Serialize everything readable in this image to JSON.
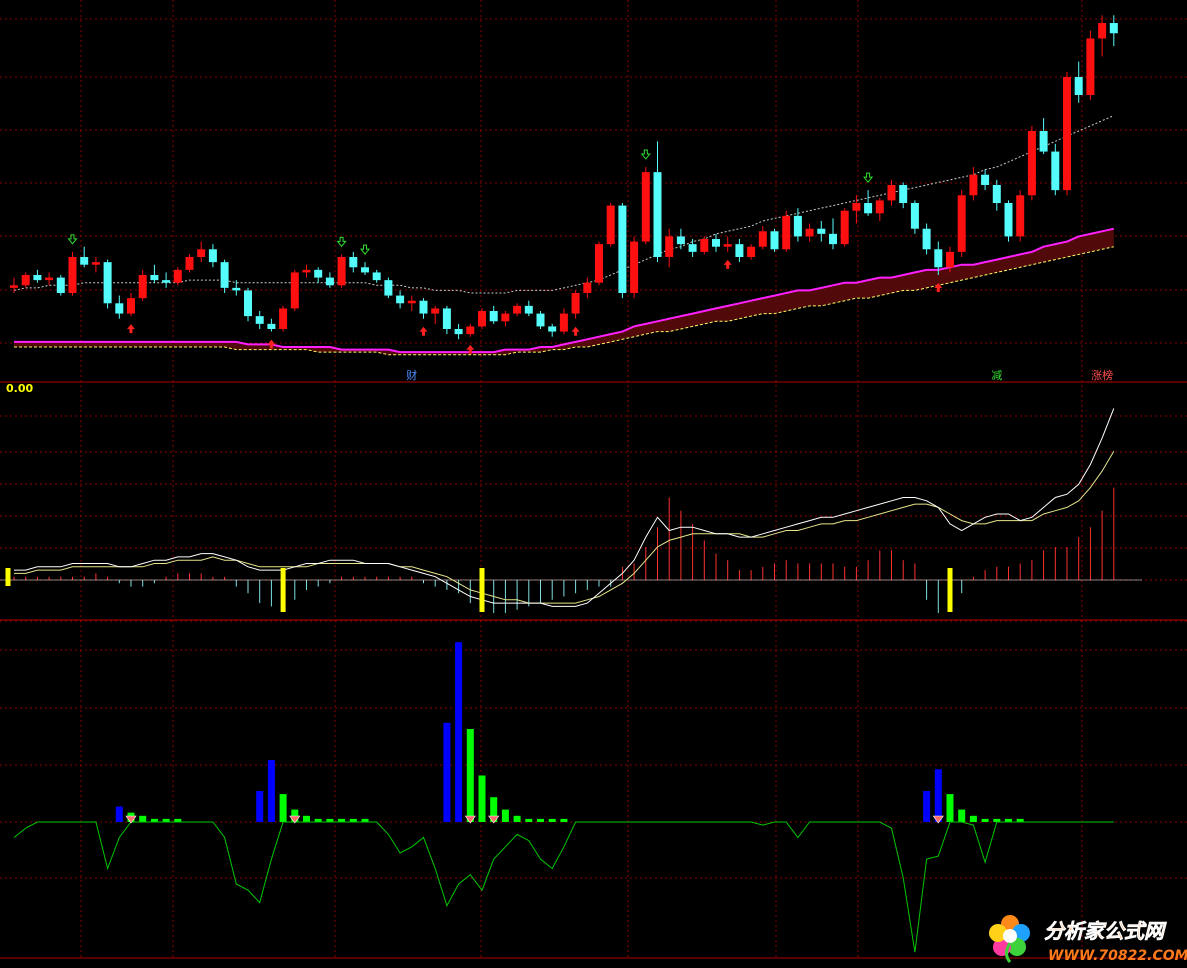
{
  "chart_data": [
    {
      "type": "candlestick",
      "panel": "price",
      "ohlc": [
        [
          300,
          304,
          298,
          301
        ],
        [
          301,
          306,
          300,
          305
        ],
        [
          305,
          307,
          302,
          303
        ],
        [
          303,
          306,
          301,
          304
        ],
        [
          304,
          305,
          297,
          298
        ],
        [
          298,
          314,
          297,
          312
        ],
        [
          312,
          316,
          308,
          309
        ],
        [
          309,
          312,
          306,
          310
        ],
        [
          310,
          311,
          292,
          294
        ],
        [
          294,
          297,
          288,
          290
        ],
        [
          290,
          298,
          289,
          296
        ],
        [
          296,
          307,
          295,
          305
        ],
        [
          305,
          309,
          302,
          303
        ],
        [
          303,
          306,
          300,
          302
        ],
        [
          302,
          308,
          301,
          307
        ],
        [
          307,
          313,
          306,
          312
        ],
        [
          312,
          318,
          310,
          315
        ],
        [
          315,
          317,
          308,
          310
        ],
        [
          310,
          311,
          298,
          300
        ],
        [
          300,
          303,
          297,
          299
        ],
        [
          299,
          300,
          287,
          289
        ],
        [
          289,
          291,
          284,
          286
        ],
        [
          286,
          288,
          283,
          284
        ],
        [
          284,
          293,
          283,
          292
        ],
        [
          292,
          307,
          291,
          306
        ],
        [
          306,
          309,
          304,
          307
        ],
        [
          307,
          308,
          302,
          304
        ],
        [
          304,
          306,
          300,
          301
        ],
        [
          301,
          313,
          300,
          312
        ],
        [
          312,
          314,
          306,
          308
        ],
        [
          308,
          310,
          305,
          306
        ],
        [
          306,
          307,
          302,
          303
        ],
        [
          303,
          304,
          296,
          297
        ],
        [
          297,
          299,
          292,
          294
        ],
        [
          294,
          297,
          291,
          295
        ],
        [
          295,
          296,
          288,
          290
        ],
        [
          290,
          293,
          286,
          292
        ],
        [
          292,
          293,
          282,
          284
        ],
        [
          284,
          286,
          280,
          282
        ],
        [
          282,
          286,
          281,
          285
        ],
        [
          285,
          292,
          284,
          291
        ],
        [
          291,
          293,
          286,
          287
        ],
        [
          287,
          291,
          285,
          290
        ],
        [
          290,
          294,
          289,
          293
        ],
        [
          293,
          295,
          289,
          290
        ],
        [
          290,
          291,
          284,
          285
        ],
        [
          285,
          286,
          281,
          283
        ],
        [
          283,
          292,
          282,
          290
        ],
        [
          290,
          299,
          288,
          298
        ],
        [
          298,
          304,
          296,
          302
        ],
        [
          302,
          318,
          301,
          317
        ],
        [
          317,
          333,
          316,
          332
        ],
        [
          332,
          333,
          296,
          298
        ],
        [
          298,
          320,
          296,
          318
        ],
        [
          318,
          347,
          317,
          345
        ],
        [
          345,
          357,
          310,
          312
        ],
        [
          312,
          323,
          308,
          320
        ],
        [
          320,
          323,
          315,
          317
        ],
        [
          317,
          319,
          312,
          314
        ],
        [
          314,
          320,
          313,
          319
        ],
        [
          319,
          321,
          314,
          316
        ],
        [
          316,
          320,
          314,
          317
        ],
        [
          317,
          319,
          310,
          312
        ],
        [
          312,
          317,
          311,
          316
        ],
        [
          316,
          324,
          315,
          322
        ],
        [
          322,
          323,
          314,
          315
        ],
        [
          315,
          330,
          314,
          328
        ],
        [
          328,
          331,
          318,
          320
        ],
        [
          320,
          325,
          318,
          323
        ],
        [
          323,
          326,
          318,
          321
        ],
        [
          321,
          327,
          315,
          317
        ],
        [
          317,
          331,
          316,
          330
        ],
        [
          330,
          336,
          325,
          333
        ],
        [
          333,
          338,
          328,
          329
        ],
        [
          329,
          335,
          326,
          334
        ],
        [
          334,
          342,
          332,
          340
        ],
        [
          340,
          341,
          331,
          333
        ],
        [
          333,
          334,
          321,
          323
        ],
        [
          323,
          325,
          313,
          315
        ],
        [
          315,
          318,
          305,
          308
        ],
        [
          308,
          316,
          306,
          314
        ],
        [
          314,
          338,
          312,
          336
        ],
        [
          336,
          347,
          334,
          344
        ],
        [
          344,
          346,
          338,
          340
        ],
        [
          340,
          342,
          330,
          333
        ],
        [
          333,
          334,
          318,
          320
        ],
        [
          320,
          338,
          318,
          336
        ],
        [
          336,
          363,
          334,
          361
        ],
        [
          361,
          366,
          352,
          353
        ],
        [
          353,
          356,
          336,
          338
        ],
        [
          338,
          384,
          336,
          382
        ],
        [
          382,
          388,
          372,
          375
        ],
        [
          375,
          400,
          373,
          397
        ],
        [
          397,
          406,
          390,
          403
        ],
        [
          403,
          406,
          394,
          399
        ]
      ],
      "ma_long": [
        299,
        300,
        300,
        301,
        301,
        301,
        302,
        302,
        302,
        302,
        302,
        302,
        302,
        302,
        302,
        303,
        303,
        303,
        303,
        302,
        302,
        302,
        302,
        302,
        302,
        302,
        302,
        302,
        302,
        302,
        302,
        301,
        301,
        301,
        300,
        300,
        299,
        299,
        299,
        298,
        298,
        298,
        298,
        299,
        299,
        299,
        299,
        300,
        301,
        302,
        303,
        305,
        307,
        309,
        311,
        313,
        315,
        316,
        318,
        319,
        321,
        322,
        323,
        324,
        326,
        327,
        328,
        329,
        330,
        331,
        332,
        333,
        334,
        335,
        336,
        337,
        338,
        339,
        340,
        341,
        342,
        343,
        344,
        346,
        347,
        349,
        351,
        353,
        355,
        357,
        359,
        361,
        363,
        365,
        367
      ],
      "ma_mid": [
        279,
        279,
        279,
        279,
        279,
        279,
        279,
        279,
        279,
        279,
        279,
        279,
        279,
        279,
        279,
        279,
        279,
        279,
        279,
        279,
        278,
        278,
        278,
        277,
        277,
        277,
        277,
        277,
        276,
        276,
        276,
        276,
        276,
        275,
        275,
        275,
        275,
        275,
        275,
        275,
        275,
        275,
        276,
        276,
        276,
        277,
        277,
        278,
        279,
        280,
        281,
        282,
        283,
        285,
        286,
        287,
        288,
        289,
        290,
        291,
        292,
        293,
        294,
        295,
        296,
        297,
        298,
        299,
        299,
        300,
        301,
        302,
        302,
        303,
        304,
        304,
        305,
        306,
        307,
        307,
        308,
        309,
        309,
        310,
        311,
        312,
        313,
        314,
        316,
        317,
        318,
        320,
        321,
        322,
        323
      ],
      "ma_low": [
        277,
        277,
        277,
        277,
        277,
        277,
        277,
        277,
        277,
        277,
        277,
        277,
        277,
        277,
        277,
        277,
        277,
        277,
        277,
        276,
        276,
        276,
        276,
        276,
        276,
        276,
        275,
        275,
        275,
        275,
        275,
        275,
        274,
        274,
        274,
        274,
        274,
        274,
        274,
        274,
        274,
        274,
        274,
        275,
        275,
        275,
        276,
        276,
        277,
        277,
        278,
        279,
        280,
        281,
        282,
        283,
        283,
        284,
        285,
        286,
        287,
        287,
        288,
        289,
        290,
        290,
        291,
        292,
        293,
        293,
        294,
        295,
        296,
        296,
        297,
        298,
        299,
        299,
        300,
        301,
        302,
        303,
        304,
        305,
        306,
        307,
        308,
        309,
        310,
        311,
        312,
        313,
        314,
        315,
        316
      ],
      "buy_arrows": [
        10,
        22,
        35,
        39,
        48,
        61,
        79
      ],
      "sell_arrows": [
        5,
        28,
        30,
        54,
        73
      ],
      "tags": [
        {
          "text": "财",
          "bar": 34,
          "color": "#4f8cff"
        },
        {
          "text": "减",
          "bar": 84,
          "color": "#2fdc2f"
        },
        {
          "text": "涨榜",
          "bar": 93,
          "color": "#ff5050"
        }
      ],
      "ylim": [
        270,
        410
      ]
    },
    {
      "type": "indicator",
      "panel": "oscillator",
      "readout": "0.00",
      "hist": [
        1,
        1,
        1,
        1,
        1,
        1,
        1,
        2,
        1,
        -1,
        -2,
        -2,
        -1,
        1,
        2,
        2,
        2,
        1,
        1,
        -2,
        -4,
        -7,
        -8,
        -8,
        -6,
        -3,
        -2,
        -1,
        1,
        1,
        1,
        1,
        1,
        1,
        1,
        -1,
        -2,
        -3,
        -4,
        -7,
        -9,
        -10,
        -10,
        -9,
        -8,
        -7,
        -6,
        -5,
        -4,
        -3,
        -2,
        -2,
        4,
        5,
        10,
        16,
        25,
        21,
        17,
        12,
        8,
        6,
        3,
        3,
        4,
        5,
        6,
        5,
        5,
        5,
        5,
        4,
        4,
        6,
        9,
        9,
        6,
        5,
        -6,
        -10,
        -8,
        -4,
        1,
        3,
        4,
        4,
        5,
        6,
        9,
        10,
        10,
        13,
        16,
        21,
        28
      ],
      "line1": [
        3,
        3,
        4,
        4,
        4,
        5,
        5,
        5,
        5,
        4,
        4,
        5,
        6,
        6,
        7,
        7,
        8,
        8,
        7,
        6,
        4,
        3,
        3,
        3,
        4,
        5,
        5,
        6,
        6,
        6,
        5,
        5,
        5,
        4,
        3,
        2,
        1,
        -1,
        -3,
        -5,
        -6,
        -7,
        -7,
        -7,
        -7,
        -7,
        -8,
        -8,
        -8,
        -7,
        -4,
        -1,
        2,
        6,
        13,
        19,
        15,
        16,
        16,
        15,
        14,
        14,
        13,
        13,
        14,
        15,
        16,
        17,
        18,
        19,
        19,
        20,
        21,
        22,
        23,
        24,
        25,
        25,
        24,
        22,
        17,
        15,
        17,
        19,
        20,
        20,
        18,
        19,
        22,
        25,
        26,
        29,
        35,
        43,
        52
      ],
      "line2": [
        2,
        2,
        3,
        3,
        3,
        4,
        4,
        4,
        4,
        4,
        4,
        4,
        5,
        5,
        6,
        6,
        6,
        7,
        6,
        6,
        5,
        4,
        4,
        4,
        4,
        4,
        5,
        5,
        5,
        5,
        5,
        5,
        5,
        4,
        4,
        3,
        2,
        1,
        -1,
        -3,
        -4,
        -5,
        -6,
        -6,
        -7,
        -7,
        -7,
        -7,
        -7,
        -6,
        -5,
        -3,
        -1,
        2,
        6,
        10,
        12,
        13,
        14,
        14,
        14,
        14,
        14,
        13,
        13,
        14,
        15,
        15,
        16,
        17,
        17,
        18,
        18,
        19,
        20,
        21,
        22,
        23,
        23,
        22,
        20,
        18,
        17,
        17,
        18,
        18,
        18,
        18,
        20,
        21,
        22,
        24,
        28,
        33,
        39
      ],
      "signal_bars": [
        0,
        23,
        40,
        80
      ]
    },
    {
      "type": "indicator",
      "panel": "volume_signal",
      "blue_bars": [
        [
          9,
          5
        ],
        [
          21,
          10
        ],
        [
          22,
          20
        ],
        [
          37,
          32
        ],
        [
          38,
          58
        ],
        [
          78,
          10
        ],
        [
          79,
          17
        ]
      ],
      "green_bars": [
        [
          10,
          3
        ],
        [
          11,
          2
        ],
        [
          12,
          1
        ],
        [
          13,
          1
        ],
        [
          14,
          1
        ],
        [
          23,
          9
        ],
        [
          24,
          4
        ],
        [
          25,
          2
        ],
        [
          26,
          1
        ],
        [
          27,
          1
        ],
        [
          28,
          1
        ],
        [
          29,
          1
        ],
        [
          30,
          1
        ],
        [
          39,
          30
        ],
        [
          40,
          15
        ],
        [
          41,
          8
        ],
        [
          42,
          4
        ],
        [
          43,
          2
        ],
        [
          44,
          1
        ],
        [
          45,
          1
        ],
        [
          46,
          1
        ],
        [
          47,
          1
        ],
        [
          80,
          9
        ],
        [
          81,
          4
        ],
        [
          82,
          2
        ],
        [
          83,
          1
        ],
        [
          84,
          1
        ],
        [
          85,
          1
        ],
        [
          86,
          1
        ]
      ],
      "line": [
        -5,
        -2,
        0,
        0,
        0,
        0,
        0,
        0,
        -15,
        -5,
        0,
        0,
        0,
        0,
        0,
        0,
        0,
        0,
        -5,
        -20,
        -22,
        -26,
        -12,
        0,
        0,
        0,
        0,
        0,
        0,
        0,
        0,
        0,
        -4,
        -10,
        -8,
        -5,
        -15,
        -27,
        -20,
        -17,
        -22,
        -12,
        -8,
        -4,
        -6,
        -12,
        -15,
        -8,
        0,
        0,
        0,
        0,
        0,
        0,
        0,
        0,
        0,
        0,
        0,
        0,
        0,
        0,
        0,
        0,
        -1,
        0,
        0,
        -5,
        0,
        0,
        0,
        0,
        0,
        0,
        0,
        -2,
        -18,
        -42,
        -12,
        -11,
        0,
        0,
        -1,
        -13,
        0,
        0,
        0,
        0,
        0,
        0,
        0,
        0,
        0,
        0,
        0
      ],
      "markers": [
        10,
        24,
        39,
        41,
        79
      ]
    }
  ],
  "watermark": {
    "title": "分析家公式网",
    "url": "WWW.70822.COM"
  },
  "colors": {
    "up": "#ff1010",
    "down": "#54fcfc",
    "ma_long": "#cccccc",
    "ma_mid": "#ff20ff",
    "ma_low": "#ffff66",
    "grid": "#8b0000",
    "line1": "#ffffff",
    "line2": "#e6e68c",
    "buy": "#ff2020",
    "sell": "#30e030",
    "signal": "#ffff00",
    "blue": "#0000ff",
    "green": "#00ff00",
    "line3": "#00c800"
  }
}
